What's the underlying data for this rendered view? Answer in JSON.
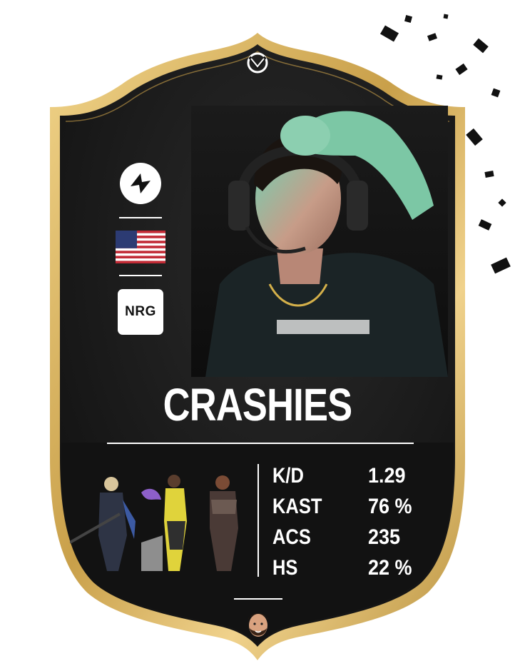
{
  "card": {
    "player_name": "CRASHIES",
    "team_logo_icon": "team-logo-icon",
    "flag_icon": "usa-flag-icon",
    "org_logo_text": "NRG",
    "top_emblem_icon": "valorant-emblem-icon",
    "colors": {
      "frame_gold": "#d9b45a",
      "card_black": "#141414",
      "text_white": "#ffffff"
    }
  },
  "stats": [
    {
      "label": "K/D",
      "value": "1.29"
    },
    {
      "label": "KAST",
      "value": "76 %"
    },
    {
      "label": "ACS",
      "value": "235"
    },
    {
      "label": "HS",
      "value": "22 %"
    }
  ],
  "agents": [
    "agent-sova-icon",
    "agent-killjoy-icon",
    "agent-kayo-icon"
  ],
  "creator_avatar_icon": "creator-avatar-icon"
}
